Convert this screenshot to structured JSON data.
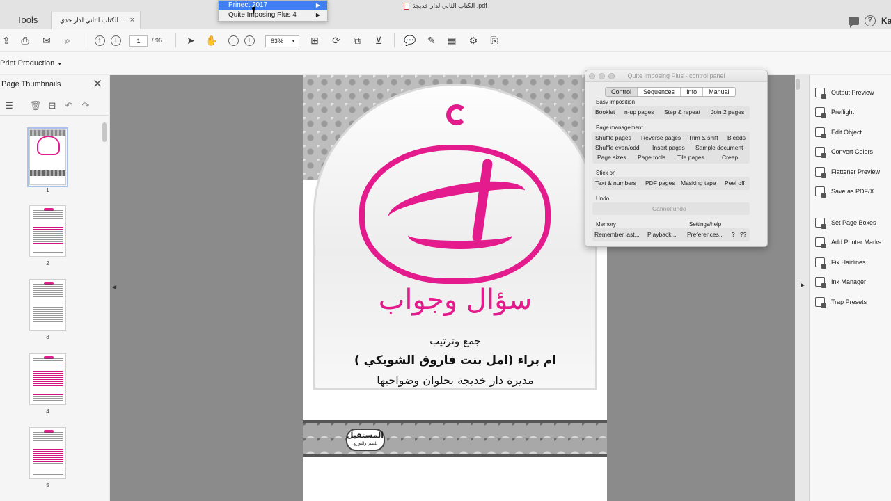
{
  "window": {
    "title": "الكتاب الثاني لدار خديجة .pdf"
  },
  "tabs": {
    "tools_label": "Tools",
    "document_label": "الكتاب الثاني لدار خدي...",
    "close_glyph": "×",
    "help_glyph": "?",
    "user_abbr": "Ka"
  },
  "context_menu": {
    "items": [
      {
        "label": "Prinect 2017",
        "arrow": "▶",
        "active": true
      },
      {
        "label": "Quite Imposing Plus 4",
        "arrow": "▶",
        "active": false
      }
    ]
  },
  "toolbar": {
    "current_page": "1",
    "total_pages": "/ 96",
    "zoom": "83%",
    "dropdown_glyph": "▼",
    "icons": [
      "upload-icon",
      "print-icon",
      "mail-icon",
      "search-icon",
      "page-up-icon",
      "page-down-icon",
      "select-arrow-icon",
      "hand-tool-icon",
      "zoom-out-icon",
      "zoom-in-icon",
      "fit-page-icon",
      "rotate-icon",
      "crop-icon",
      "stamp-icon",
      "comment-icon",
      "pen-icon",
      "text-recognition-icon",
      "gear-icon",
      "output-icon"
    ]
  },
  "toolset": {
    "label": "Print Production",
    "dropdown_glyph": "▼"
  },
  "thumbnails": {
    "title": "Page Thumbnails",
    "close_glyph": "✕",
    "pages": [
      {
        "num": "1"
      },
      {
        "num": "2"
      },
      {
        "num": "3"
      },
      {
        "num": "4"
      },
      {
        "num": "5"
      }
    ]
  },
  "document": {
    "title_ar": "سؤال وجواب",
    "line1": "جمع وترتيب",
    "line2": "ام براء (امل بنت فاروق الشوبكي )",
    "line3": "مديرة دار خديجة بحلوان وضواحيها",
    "publisher_line1": "المستقبل",
    "publisher_line2": "للنشر والتوزيع"
  },
  "qi_panel": {
    "title": "Quite Imposing Plus - control panel",
    "tabs": [
      {
        "label": "Control",
        "active": true
      },
      {
        "label": "Sequences",
        "active": false
      },
      {
        "label": "Info",
        "active": false
      },
      {
        "label": "Manual",
        "active": false
      }
    ],
    "sections": {
      "easy_imposition": "Easy imposition",
      "page_management": "Page management",
      "stick_on": "Stick on",
      "undo": "Undo",
      "memory": "Memory",
      "settings_help": "Settings/help"
    },
    "buttons": {
      "booklet": "Booklet",
      "nup_pages": "n-up pages",
      "step_repeat": "Step & repeat",
      "join_2_pages": "Join 2 pages",
      "shuffle_pages": "Shuffle pages",
      "reverse_pages": "Reverse pages",
      "trim_shift": "Trim & shift",
      "bleeds": "Bleeds",
      "shuffle_even_odd": "Shuffle even/odd",
      "insert_pages": "Insert pages",
      "sample_document": "Sample document",
      "page_sizes": "Page sizes",
      "page_tools": "Page tools",
      "tile_pages": "Tile pages",
      "creep": "Creep",
      "text_numbers": "Text & numbers",
      "pdf_pages": "PDF pages",
      "masking_tape": "Masking tape",
      "peel_off": "Peel off",
      "cannot_undo": "Cannot undo",
      "remember_last": "Remember last...",
      "playback": "Playback...",
      "preferences": "Preferences...",
      "help_q": "?",
      "help_qq": "??"
    }
  },
  "right_pane": {
    "items": [
      {
        "label": "Output Preview",
        "icon": "output-preview-icon"
      },
      {
        "label": "Preflight",
        "icon": "preflight-icon"
      },
      {
        "label": "Edit Object",
        "icon": "edit-object-icon"
      },
      {
        "label": "Convert Colors",
        "icon": "convert-colors-icon"
      },
      {
        "label": "Flattener Preview",
        "icon": "flattener-preview-icon"
      },
      {
        "label": "Save as PDF/X",
        "icon": "save-pdfx-icon"
      },
      {
        "label": "Set Page Boxes",
        "icon": "set-page-boxes-icon"
      },
      {
        "label": "Add Printer Marks",
        "icon": "printer-marks-icon"
      },
      {
        "label": "Fix Hairlines",
        "icon": "fix-hairlines-icon"
      },
      {
        "label": "Ink Manager",
        "icon": "ink-manager-icon"
      },
      {
        "label": "Trap Presets",
        "icon": "trap-presets-icon"
      }
    ]
  },
  "colors": {
    "accent_pink": "#e31b8c",
    "menu_highlight": "#3f7ff2",
    "doc_background": "#8b8b8b"
  }
}
